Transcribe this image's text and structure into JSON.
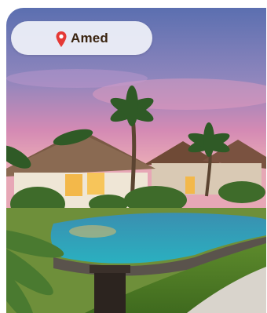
{
  "card": {
    "location": "Amed",
    "location_icon": "map-pin-icon",
    "image_subject": "tropical-resort-pool-at-dusk"
  },
  "colors": {
    "pin": "#e53935",
    "location_text": "#3a2410",
    "pill_background": "#eef0f8"
  }
}
